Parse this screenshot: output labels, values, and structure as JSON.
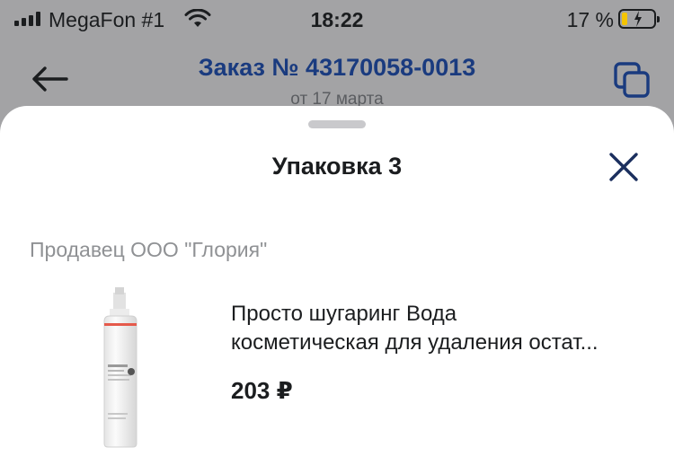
{
  "status_bar": {
    "carrier": "MegaFon #1",
    "time": "18:22",
    "battery_percent": "17 %",
    "battery_level": 0.17
  },
  "header": {
    "title": "Заказ № 43170058-0013",
    "subtitle": "от 17 марта"
  },
  "sheet": {
    "title": "Упаковка 3",
    "seller": "Продавец ООО \"Глория\"",
    "product": {
      "name_line1": "Просто шугаринг Вода",
      "name_line2": "косметическая для удаления остат...",
      "price": "203 ₽"
    }
  },
  "icons": {
    "back": "arrow-left-icon",
    "copy": "copy-icon",
    "close": "close-icon"
  },
  "colors": {
    "accent": "#1a3b7f",
    "battery": "#f5c400"
  }
}
